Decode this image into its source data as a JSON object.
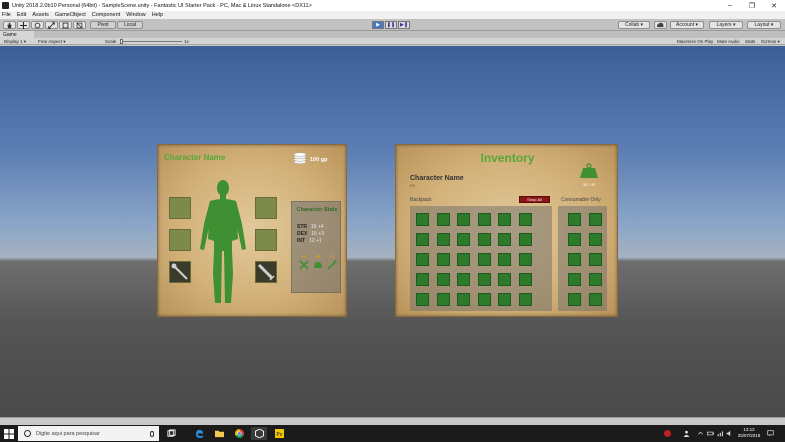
{
  "window": {
    "title": "Unity 2018.2.0b10 Personal (64bit) - SampleScene.unity - Fantastic UI Starter Pack - PC, Mac & Linux Standalone <DX11>",
    "controls": [
      "–",
      "❐",
      "✕"
    ]
  },
  "menu": [
    "File",
    "Edit",
    "Assets",
    "GameObject",
    "Component",
    "Window",
    "Help"
  ],
  "toolbar": {
    "pivot": "Pivot",
    "local": "Local",
    "collab": "Collab ▾",
    "account": "Account ▾",
    "layers": "Layers ▾",
    "layout": "Layout ▾"
  },
  "game_view": {
    "tab": "Game",
    "display": "Display 1",
    "aspect": "Free Aspect",
    "scale_label": "Scale",
    "scale_value": "1x",
    "maximize": "Maximize On Play",
    "mute": "Mute Audio",
    "stats": "Stats",
    "gizmos": "Gizmos ▾"
  },
  "character_panel": {
    "name": "Character Name",
    "gold": "100 gp",
    "stats_title": "Character Stats",
    "stats": [
      {
        "label": "STR",
        "value": "16 +4"
      },
      {
        "label": "DEX",
        "value": "16 +3"
      },
      {
        "label": "INT",
        "value": "12 +1"
      }
    ],
    "bonuses": [
      "+4",
      "+8",
      "+2"
    ]
  },
  "inventory_panel": {
    "title": "Inventory",
    "character_name": "Character Name",
    "character_sub": "Elf",
    "weight": "35 / 45",
    "backpack_label": "Backpack",
    "shop_all": "Shop All",
    "consumable_label": "Consumable Only"
  },
  "taskbar": {
    "search_placeholder": "Digite aqui para pesquisar",
    "time": "13:12",
    "date": "25/07/2018"
  },
  "colors": {
    "accent_green": "#55a83a",
    "slot_green": "#2d7a2b",
    "shop_red": "#8c1414",
    "play_active": "#4a78c6"
  }
}
